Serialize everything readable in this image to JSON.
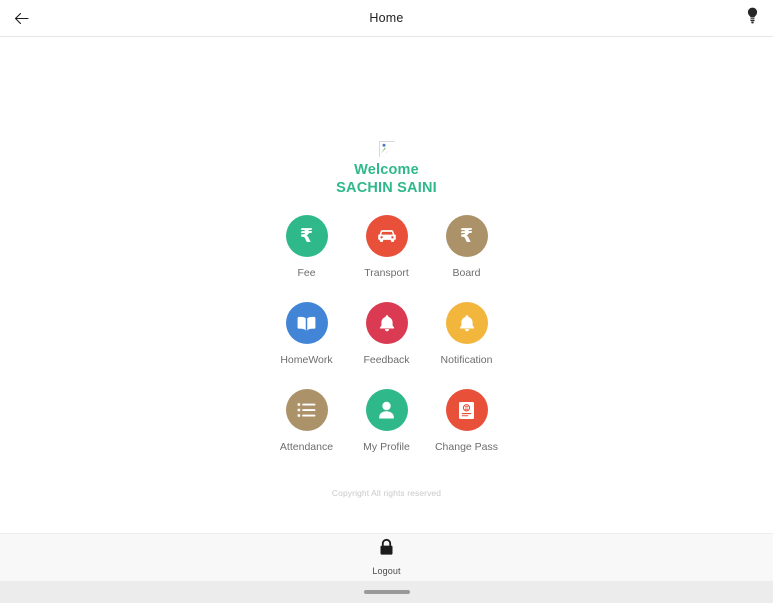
{
  "header": {
    "title": "Home",
    "back_icon": "arrow-left-icon",
    "action_icon": "lightbulb-icon"
  },
  "welcome": {
    "image_alt": "profile-photo",
    "greeting": "Welcome",
    "user_name": "SACHIN SAINI",
    "accent_color": "#2fb98a"
  },
  "menu": {
    "items": [
      {
        "label": "Fee",
        "icon": "rupee-icon",
        "color": "#2fb98a"
      },
      {
        "label": "Transport",
        "icon": "car-icon",
        "color": "#e8503a"
      },
      {
        "label": "Board",
        "icon": "rupee-icon",
        "color": "#ab9269"
      },
      {
        "label": "HomeWork",
        "icon": "book-icon",
        "color": "#4285d6"
      },
      {
        "label": "Feedback",
        "icon": "bell-icon",
        "color": "#da3b52"
      },
      {
        "label": "Notification",
        "icon": "bell-icon",
        "color": "#f2b63c"
      },
      {
        "label": "Attendance",
        "icon": "list-icon",
        "color": "#ab9269"
      },
      {
        "label": "My Profile",
        "icon": "person-icon",
        "color": "#2fb98a"
      },
      {
        "label": "Change Pass",
        "icon": "id-card-icon",
        "color": "#e8503a"
      }
    ]
  },
  "footer": {
    "copyright": "Copyright All rights reserved"
  },
  "bottom_bar": {
    "logout_label": "Logout",
    "logout_icon": "lock-icon"
  },
  "system": {
    "home_indicator": "home-indicator"
  }
}
